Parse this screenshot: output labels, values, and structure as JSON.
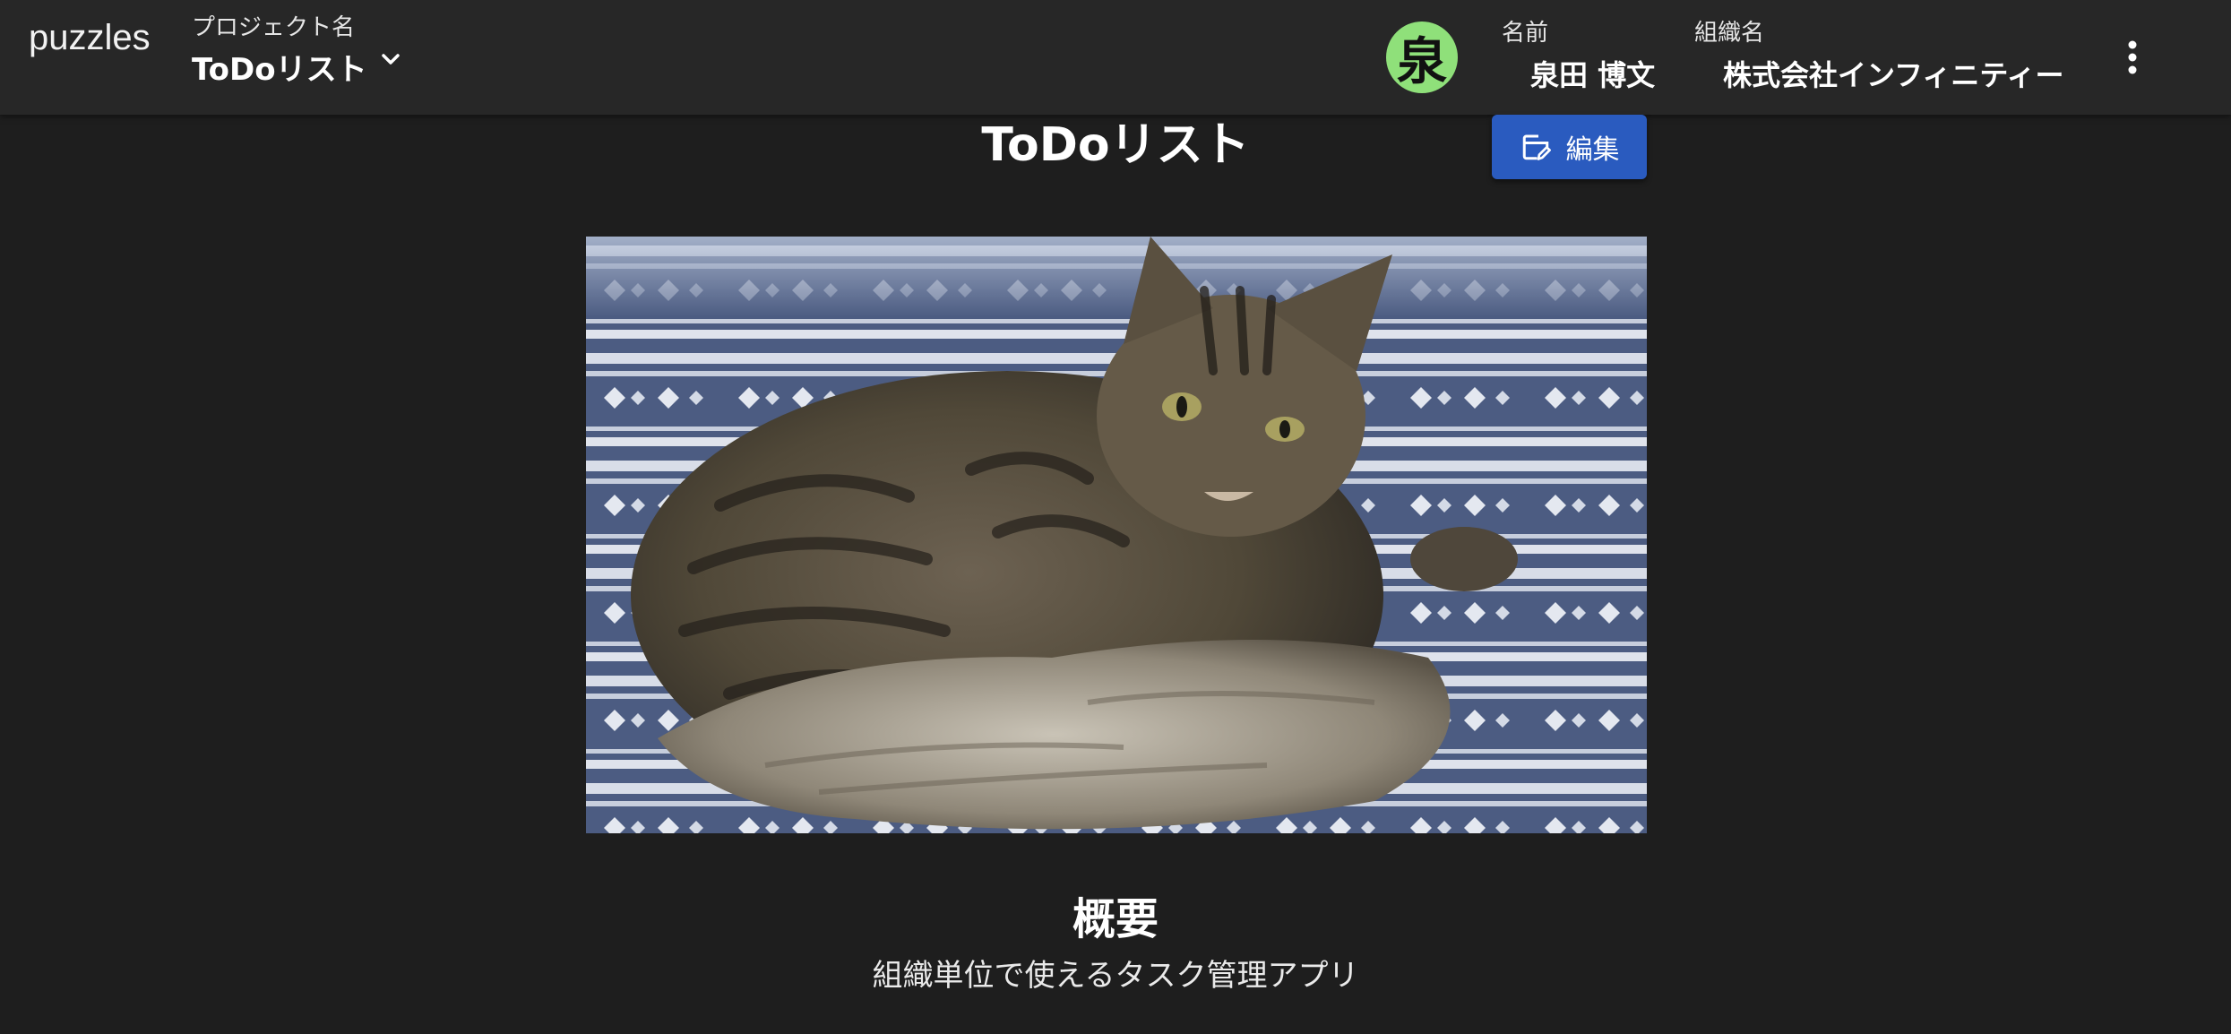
{
  "appbar": {
    "brand": "puzzles",
    "project_caption": "プロジェクト名",
    "project_name": "ToDoリスト",
    "avatar_initial": "泉",
    "avatar_color": "#8fe07a",
    "user_caption": "名前",
    "user_name": "泉田 博文",
    "org_caption": "組織名",
    "org_name": "株式会社インフィニティー"
  },
  "main": {
    "title": "ToDoリスト",
    "edit_label": "編集",
    "edit_icon": "edit-note-icon",
    "image_alt": "tabby cat lying on a blue and white patterned blanket",
    "section_title": "概要",
    "section_body": "組織単位で使えるタスク管理アプリ"
  },
  "colors": {
    "background": "#1e1e1e",
    "appbar": "#272727",
    "accent": "#2a5bbf"
  }
}
